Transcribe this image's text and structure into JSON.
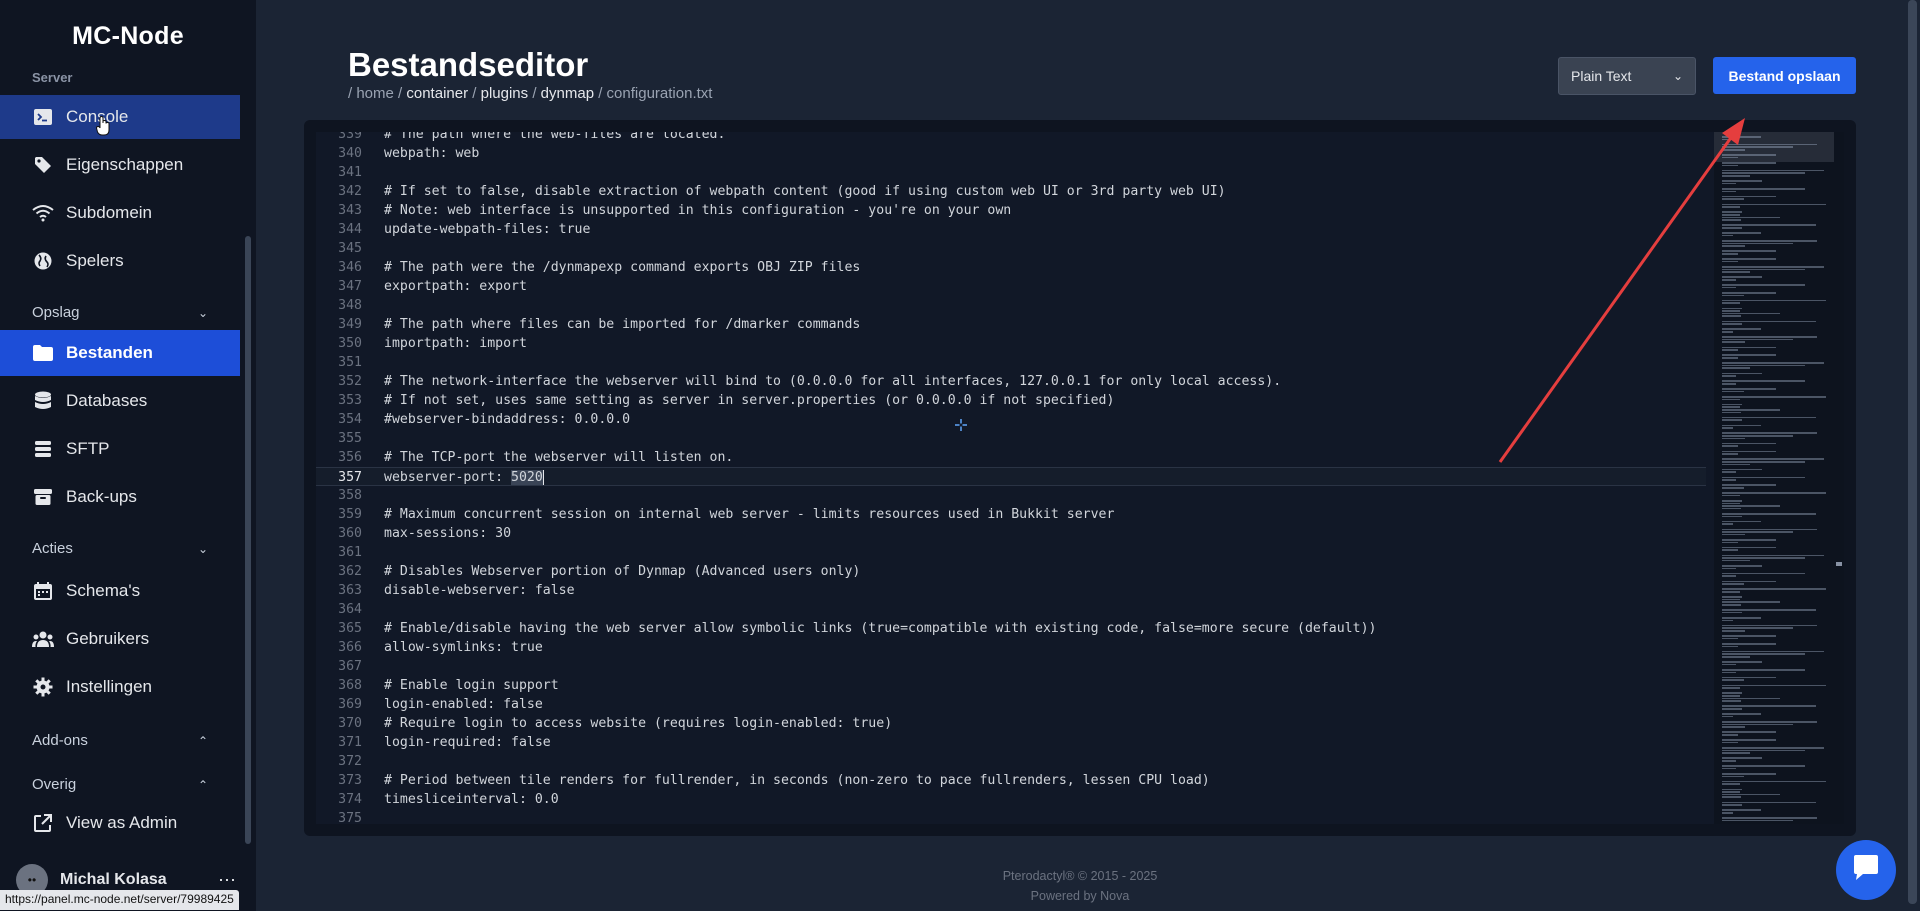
{
  "sidebar": {
    "brand": "MC-Node",
    "cut_section_label": "Server",
    "items": [
      {
        "name": "sidebar-item-console",
        "label": "Console",
        "icon": "terminal-icon"
      },
      {
        "name": "sidebar-item-eigenschappen",
        "label": "Eigenschappen",
        "icon": "tag-icon"
      },
      {
        "name": "sidebar-item-subdomein",
        "label": "Subdomein",
        "icon": "wifi-icon"
      },
      {
        "name": "sidebar-item-spelers",
        "label": "Spelers",
        "icon": "globe-icon"
      }
    ],
    "sections": {
      "opslag": "Opslag",
      "acties": "Acties",
      "addons": "Add-ons",
      "overig": "Overig"
    },
    "opslag_items": [
      {
        "label": "Bestanden"
      },
      {
        "label": "Databases"
      },
      {
        "label": "SFTP"
      },
      {
        "label": "Back-ups"
      }
    ],
    "acties_items": [
      {
        "label": "Schema's"
      },
      {
        "label": "Gebruikers"
      },
      {
        "label": "Instellingen"
      }
    ],
    "overig_items": [
      {
        "label": "View as Admin"
      }
    ],
    "user_name": "Michal Kolasa",
    "status_url": "https://panel.mc-node.net/server/79989425"
  },
  "header": {
    "title": "Bestandseditor",
    "breadcrumb": {
      "home": "/ home /",
      "container": "container",
      "sep1": "/",
      "plugins": "plugins",
      "sep2": "/",
      "dynmap": "dynmap",
      "file": "/ configuration.txt"
    },
    "language": "Plain Text",
    "save_label": "Bestand opslaan"
  },
  "editor": {
    "current_line": 357,
    "lines": [
      {
        "n": "339",
        "t": "# The path where the web-files are located."
      },
      {
        "n": "340",
        "t": "webpath: web"
      },
      {
        "n": "341",
        "t": ""
      },
      {
        "n": "342",
        "t": "# If set to false, disable extraction of webpath content (good if using custom web UI or 3rd party web UI)"
      },
      {
        "n": "343",
        "t": "# Note: web interface is unsupported in this configuration - you're on your own"
      },
      {
        "n": "344",
        "t": "update-webpath-files: true"
      },
      {
        "n": "345",
        "t": ""
      },
      {
        "n": "346",
        "t": "# The path were the /dynmapexp command exports OBJ ZIP files"
      },
      {
        "n": "347",
        "t": "exportpath: export"
      },
      {
        "n": "348",
        "t": ""
      },
      {
        "n": "349",
        "t": "# The path where files can be imported for /dmarker commands"
      },
      {
        "n": "350",
        "t": "importpath: import"
      },
      {
        "n": "351",
        "t": ""
      },
      {
        "n": "352",
        "t": "# The network-interface the webserver will bind to (0.0.0.0 for all interfaces, 127.0.0.1 for only local access)."
      },
      {
        "n": "353",
        "t": "# If not set, uses same setting as server in server.properties (or 0.0.0.0 if not specified)"
      },
      {
        "n": "354",
        "t": "#webserver-bindaddress: 0.0.0.0"
      },
      {
        "n": "355",
        "t": ""
      },
      {
        "n": "356",
        "t": "# The TCP-port the webserver will listen on."
      },
      {
        "n": "357",
        "t": "webserver-port: ",
        "sel": "5020"
      },
      {
        "n": "358",
        "t": ""
      },
      {
        "n": "359",
        "t": "# Maximum concurrent session on internal web server - limits resources used in Bukkit server"
      },
      {
        "n": "360",
        "t": "max-sessions: 30"
      },
      {
        "n": "361",
        "t": ""
      },
      {
        "n": "362",
        "t": "# Disables Webserver portion of Dynmap (Advanced users only)"
      },
      {
        "n": "363",
        "t": "disable-webserver: false"
      },
      {
        "n": "364",
        "t": ""
      },
      {
        "n": "365",
        "t": "# Enable/disable having the web server allow symbolic links (true=compatible with existing code, false=more secure (default))"
      },
      {
        "n": "366",
        "t": "allow-symlinks: true"
      },
      {
        "n": "367",
        "t": ""
      },
      {
        "n": "368",
        "t": "# Enable login support"
      },
      {
        "n": "369",
        "t": "login-enabled: false"
      },
      {
        "n": "370",
        "t": "# Require login to access website (requires login-enabled: true)"
      },
      {
        "n": "371",
        "t": "login-required: false"
      },
      {
        "n": "372",
        "t": ""
      },
      {
        "n": "373",
        "t": "# Period between tile renders for fullrender, in seconds (non-zero to pace fullrenders, lessen CPU load)"
      },
      {
        "n": "374",
        "t": "timesliceinterval: 0.0"
      },
      {
        "n": "375",
        "t": ""
      }
    ]
  },
  "footer": {
    "copyright": "Pterodactyl® © 2015 - 2025",
    "powered": "Powered by Nova"
  },
  "colors": {
    "accent": "#2563eb",
    "sidebar_bg": "#0f1522",
    "page_bg": "#1b2434",
    "annotation_arrow": "#e53e3e"
  }
}
